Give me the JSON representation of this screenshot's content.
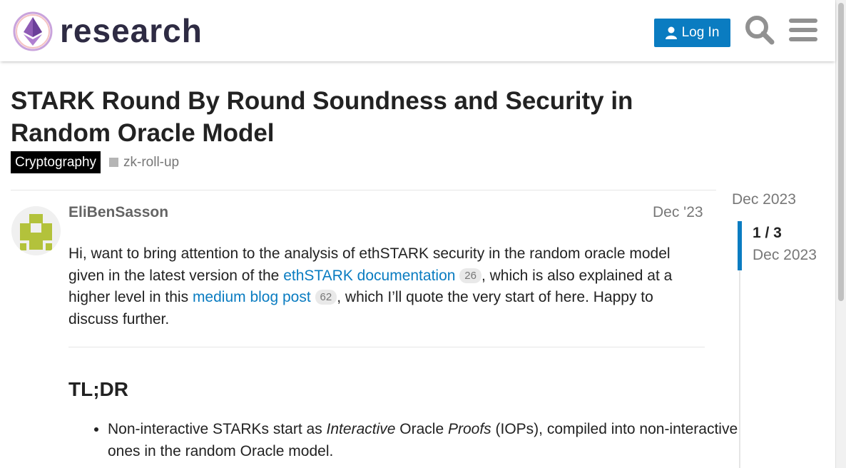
{
  "header": {
    "logo_text": "research",
    "login_label": "Log In",
    "search_icon": "search-icon",
    "menu_icon": "hamburger-menu-icon"
  },
  "topic": {
    "title": "STARK Round By Round Soundness and Security in Random Oracle Model",
    "category": "Cryptography",
    "tag": "zk-roll-up"
  },
  "post": {
    "author": "EliBenSasson",
    "date": "Dec '23",
    "para": {
      "t1": "Hi, want to bring attention to the analysis of ethSTARK security in the random oracle model given in the latest version of the ",
      "link1": "ethSTARK documentation",
      "clicks1": "26",
      "t2": ", which is also explained at a higher level in this ",
      "link2": "medium blog post",
      "clicks2": "62",
      "t3": ", which I’ll quote the very start of here. Happy to discuss further."
    },
    "heading": "TL;DR",
    "bullet1": {
      "t1": "Non-interactive STARKs start as ",
      "em1": "Interactive",
      "t2": " Oracle ",
      "em2": "Proofs",
      "t3": " (IOPs), compiled into non-interactive ones in the random Oracle model."
    }
  },
  "timeline": {
    "top_date": "Dec 2023",
    "count": "1 / 3",
    "current_date": "Dec 2023"
  },
  "colors": {
    "accent": "#0a7cc1",
    "category_bg": "#000000",
    "tag_square": "#b5b5b5",
    "avatar": "#b3c23b"
  }
}
